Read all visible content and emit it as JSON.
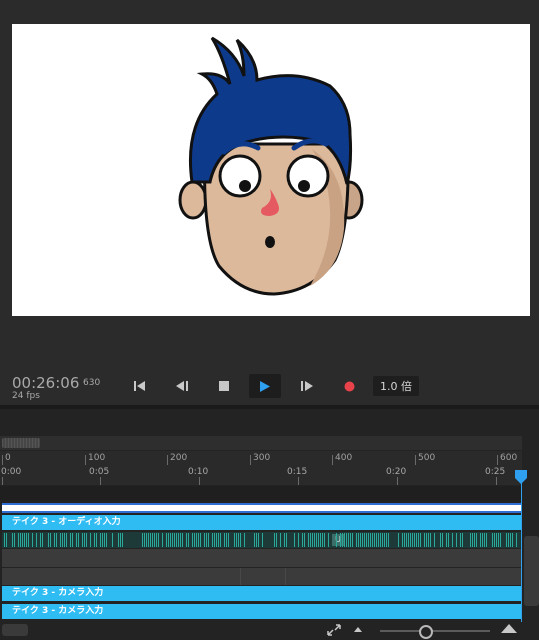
{
  "transport": {
    "timecode": "00:26:06",
    "frame": "630",
    "fps": "24 fps",
    "speed": "1.0 倍",
    "buttons": {
      "go_start": "skip-to-start-icon",
      "step_back": "step-back-icon",
      "stop": "stop-icon",
      "play": "play-icon",
      "step_forward": "step-forward-icon",
      "record": "record-icon"
    }
  },
  "timeline": {
    "frame_labels": [
      "0",
      "100",
      "200",
      "300",
      "400",
      "500",
      "600"
    ],
    "time_labels": [
      "0:00",
      "0:05",
      "0:10",
      "0:15",
      "0:20",
      "0:25"
    ],
    "tracks": {
      "audio": "テイク 3 - オーディオ入力",
      "camera_1": "テイク 3 - カメラ入力",
      "camera_2": "テイク 3 - カメラ入力"
    },
    "marker": "U",
    "zoom_level": 0.42
  },
  "colors": {
    "accent": "#2fbcf3",
    "playhead": "#2f9ff0",
    "record": "#e8424b",
    "play": "#2f9ff0",
    "hair": "#0e3a8c",
    "skin": "#dcb99b",
    "nose": "#e55a60"
  }
}
